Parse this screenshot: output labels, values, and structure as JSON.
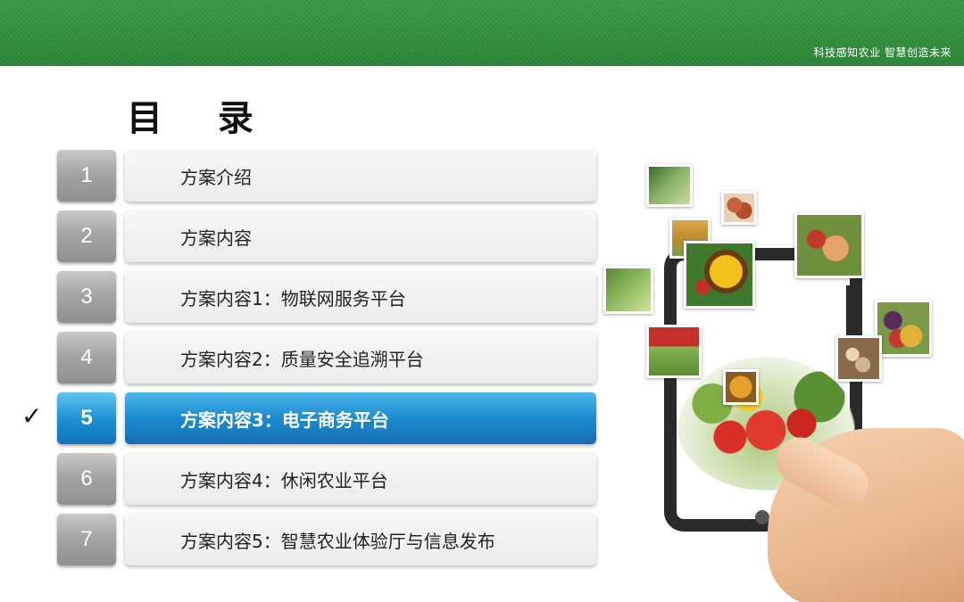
{
  "header": {
    "tagline": "科技感知农业  智慧创造未来",
    "bar_color": "#2e8b3c"
  },
  "page_title": "目 录",
  "toc": {
    "active_index": 5,
    "checkmark": "✓",
    "accent_color": "#1c8bd0",
    "items": [
      {
        "num": "1",
        "label": "方案介绍"
      },
      {
        "num": "2",
        "label": "方案内容"
      },
      {
        "num": "3",
        "label": "方案内容1：物联网服务平台"
      },
      {
        "num": "4",
        "label": "方案内容2：质量安全追溯平台"
      },
      {
        "num": "5",
        "label": "方案内容3：电子商务平台"
      },
      {
        "num": "6",
        "label": "方案内容4：休闲农业平台"
      },
      {
        "num": "7",
        "label": "方案内容5：智慧农业体验厅与信息发布"
      }
    ]
  },
  "illustration": {
    "icon": "tablet-with-farm-produce-icon"
  }
}
